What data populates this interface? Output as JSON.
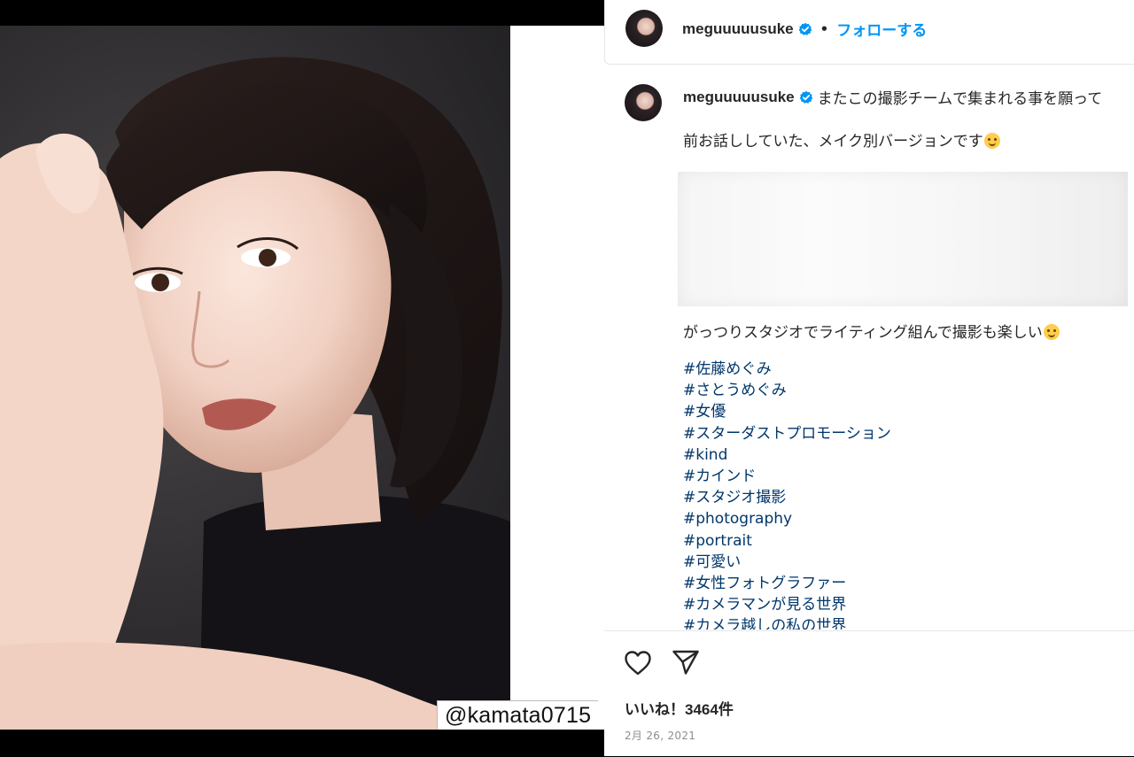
{
  "header": {
    "username": "meguuuuusuke",
    "separator": "•",
    "follow_label": "フォローする"
  },
  "media": {
    "credit_text": "@kamata0715"
  },
  "caption": {
    "username": "meguuuuusuke",
    "first_line": "またこの撮影チームで集まれる事を願って",
    "line2": "前お話ししていた、メイク別バージョンです",
    "line3": "がっつりスタジオでライティング組んで撮影も楽しい",
    "hashtags": [
      "#佐藤めぐみ",
      "#さとうめぐみ",
      "#女優",
      "#スターダストプロモーション",
      "#kind",
      "#カインド",
      "#スタジオ撮影",
      "#photography",
      "#portrait",
      "#可愛い",
      "#女性フォトグラファー",
      "#カメラマンが見る世界",
      "#カメラ越しの私の世界"
    ]
  },
  "actions": {
    "likes_text": "いいね！3464件",
    "date_text": "2月 26, 2021"
  },
  "icons": {
    "like": "heart-icon",
    "share": "paper-plane-icon",
    "verified": "verified-badge-icon",
    "emoji": "smiling-face-emoji"
  },
  "colors": {
    "link_blue": "#0095f6",
    "hashtag_blue": "#00376b",
    "verified_blue": "#0095f6",
    "text": "#262626",
    "muted": "#8e8e8e"
  }
}
